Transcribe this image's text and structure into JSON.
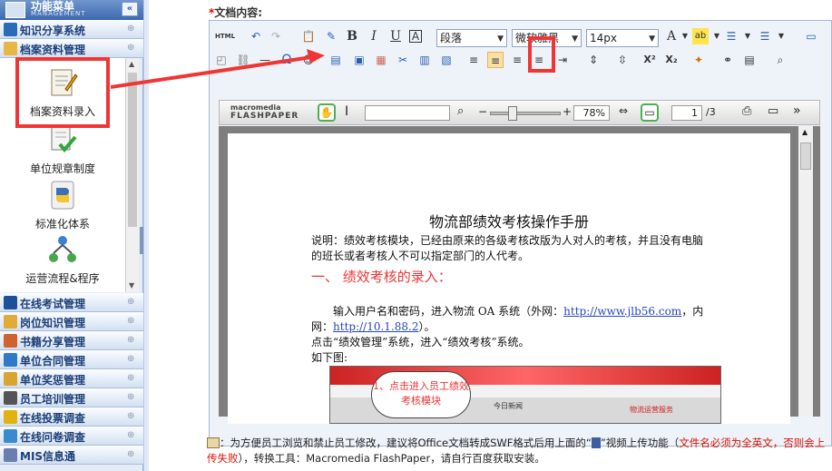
{
  "sidebar": {
    "title": "功能菜单",
    "subtitle": "MANAGEMENT",
    "collapse": "«",
    "top_items": [
      {
        "label": "知识分享系统",
        "icon": "book-icon"
      },
      {
        "label": "档案资料管理",
        "icon": "folder-icon"
      }
    ],
    "sub_items": [
      {
        "label": "档案资料录入",
        "icon": "document-edit-icon"
      },
      {
        "label": "单位规章制度",
        "icon": "checklist-icon"
      },
      {
        "label": "标准化体系",
        "icon": "python-icon"
      },
      {
        "label": "运营流程&程序",
        "icon": "flowchart-icon"
      }
    ],
    "bottom_items": [
      {
        "label": "在线考试管理"
      },
      {
        "label": "岗位知识管理"
      },
      {
        "label": "书籍分享管理"
      },
      {
        "label": "单位合同管理"
      },
      {
        "label": "单位奖惩管理"
      },
      {
        "label": "员工培训管理"
      },
      {
        "label": "在线投票调查"
      },
      {
        "label": "在线问卷调查"
      },
      {
        "label": "MIS信息通"
      }
    ],
    "expand_glyph": "⊕"
  },
  "editor": {
    "label": "文档内容:",
    "required": "*",
    "paragraph_style": "段落",
    "font_family": "微软雅黑",
    "font_size": "14px",
    "html_button": "HTML",
    "bold": "B",
    "italic": "I",
    "underline": "U",
    "strike": "A",
    "fontcolor": "A",
    "superscript": "X²",
    "subscript": "X₂"
  },
  "flashpaper": {
    "brand_top": "macromedia",
    "brand_bottom": "FLASHPAPER",
    "zoom": "78%",
    "page": "1",
    "pages": "/3"
  },
  "document": {
    "title": "物流部绩效考核操作手册",
    "intro": "说明：绩效考核模块，已经由原来的各级考核改版为人对人的考核，并且没有电脑的班长或者考核人不可以指定部门的人代考。",
    "section1": "一、 绩效考核的录入：",
    "line1_a": "输入用户名和密码，进入物流 OA 系统（外网：",
    "link1": "http://www.jlb56.com",
    "line1_b": "，内网：",
    "link2": "http://10.1.88.2",
    "line1_c": "）。",
    "line2": "点击“绩效管理”系统，进入“绩效考核”系统。",
    "line3": "如下图:",
    "bubble": "1、点击进入员工绩效考核模块",
    "shot_text_1": "今日新闻",
    "shot_text_2": "物流运营服务"
  },
  "note": {
    "part1": "：为方便员工浏览和禁止员工修改，建议将Office文档转成SWF格式后用上面的“",
    "part2": "”视频上传功能（",
    "part3": "文件名必须为全英文，否则会上传失败",
    "part4": "），转换工具：Macromedia FlashPaper，请自行百度获取安装。"
  }
}
